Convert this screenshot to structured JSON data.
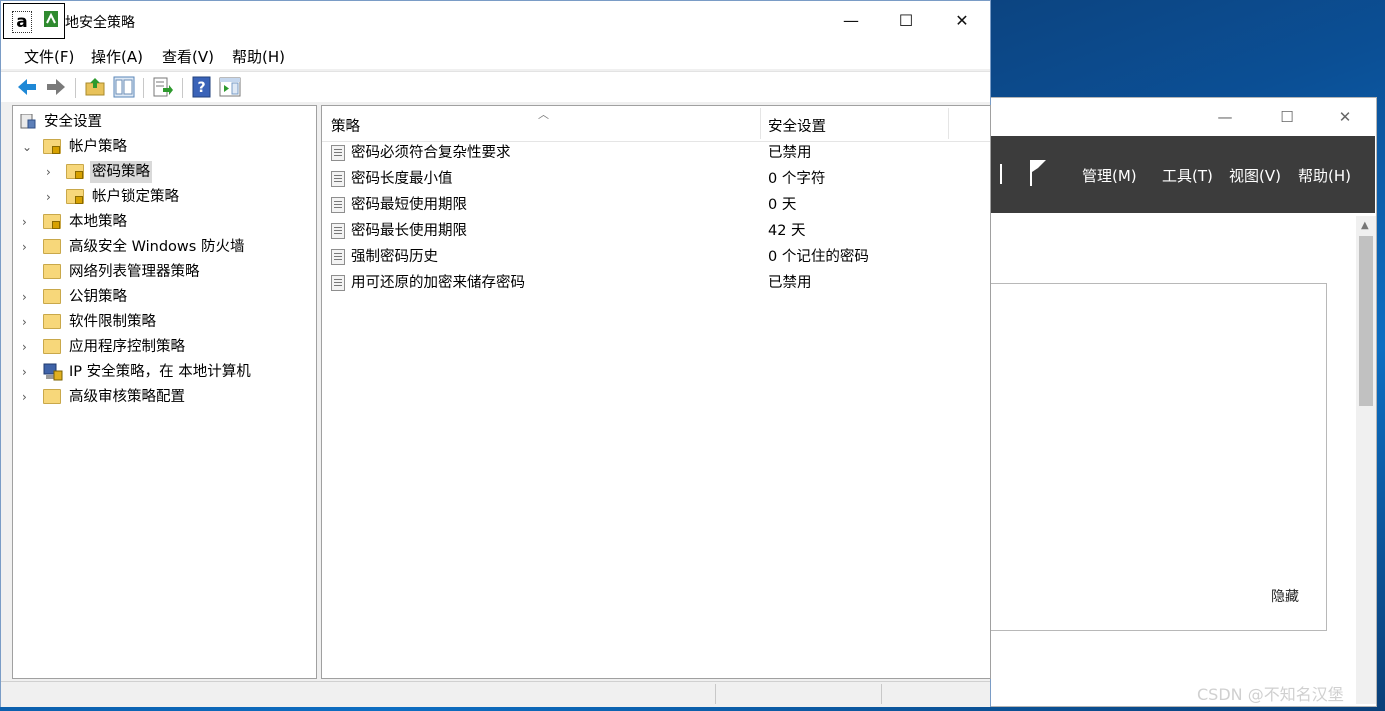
{
  "window": {
    "title": "地安全策略",
    "menu": [
      "文件(F)",
      "操作(A)",
      "查看(V)",
      "帮助(H)"
    ],
    "minimize": "—",
    "maximize": "☐",
    "close": "✕"
  },
  "tree": {
    "root": "安全设置",
    "account_policies": "帐户策略",
    "password_policy": "密码策略",
    "lockout_policy": "帐户锁定策略",
    "local_policies": "本地策略",
    "firewall": "高级安全 Windows 防火墙",
    "network_list": "网络列表管理器策略",
    "public_key": "公钥策略",
    "software_restriction": "软件限制策略",
    "app_control": "应用程序控制策略",
    "ip_security": "IP 安全策略，在 本地计算机",
    "audit": "高级审核策略配置"
  },
  "list": {
    "col_policy": "策略",
    "col_setting": "安全设置",
    "rows": [
      {
        "name": "密码必须符合复杂性要求",
        "value": "已禁用"
      },
      {
        "name": "密码长度最小值",
        "value": "0 个字符"
      },
      {
        "name": "密码最短使用期限",
        "value": "0 天"
      },
      {
        "name": "密码最长使用期限",
        "value": "42 天"
      },
      {
        "name": "强制密码历史",
        "value": "0 个记住的密码"
      },
      {
        "name": "用可还原的加密来储存密码",
        "value": "已禁用"
      }
    ]
  },
  "background_window": {
    "menu": [
      "管理(M)",
      "工具(T)",
      "视图(V)",
      "帮助(H)"
    ],
    "hide_label": "隐藏"
  },
  "watermark": "CSDN @不知名汉堡",
  "icons": {
    "back": "back-arrow-icon",
    "forward": "forward-arrow-icon",
    "up": "up-folder-icon",
    "show_tree": "show-hide-tree-icon",
    "export": "export-list-icon",
    "help": "help-icon",
    "action_pane": "action-pane-icon"
  }
}
